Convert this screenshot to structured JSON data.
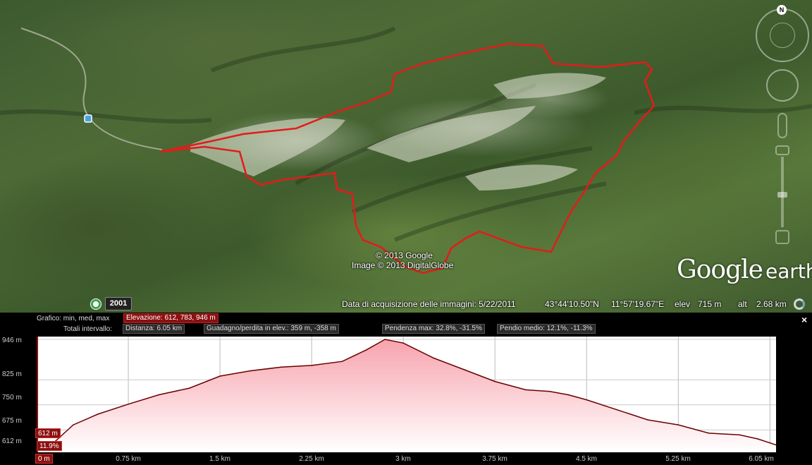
{
  "map": {
    "copyright_google": "© 2013 Google",
    "copyright_imagery": "Image © 2013 DigitalGlobe",
    "logo_google": "Google",
    "logo_earth": "earth",
    "compass_north": "N",
    "historical_year": "2001"
  },
  "status": {
    "imagery_date": "Data di acquisizione delle immagini: 5/22/2011",
    "latitude": "43°44'10.50\"N",
    "longitude": "11°57'19.67\"E",
    "elev_label": "elev",
    "elev_value": "715 m",
    "alt_label": "alt",
    "alt_value": "2.68 km"
  },
  "profile": {
    "graph_label": "Grafico: min, med, max",
    "elevation": "Elevazione: 612, 783, 946 m",
    "totals_label": "Totali intervallo:",
    "distance": "Distanza: 6.05 km",
    "gain_loss": "Guadagno/perdita in elev.: 359 m, -358 m",
    "max_slope": "Pendenza max: 32.8%, -31.5%",
    "avg_slope": "Pendio medio: 12.1%, -11.3%",
    "close": "×",
    "cursor_elev": "612 m",
    "cursor_slope": "11.9%",
    "cursor_dist": "0 m"
  },
  "chart_data": {
    "type": "area",
    "y_ticks": [
      "946 m",
      "825 m",
      "750 m",
      "675 m",
      "612 m"
    ],
    "x_ticks": [
      "0.75 km",
      "1.5 km",
      "2.25 km",
      "3 km",
      "3.75 km",
      "4.5 km",
      "5.25 km",
      "6.05 km"
    ],
    "ylim": [
      612,
      946
    ],
    "xlim": [
      0,
      6.05
    ],
    "x": [
      0,
      0.15,
      0.3,
      0.5,
      0.75,
      1.0,
      1.25,
      1.5,
      1.75,
      2.0,
      2.25,
      2.5,
      2.7,
      2.85,
      3.0,
      3.25,
      3.5,
      3.75,
      4.0,
      4.2,
      4.35,
      4.5,
      4.75,
      5.0,
      5.25,
      5.5,
      5.75,
      5.9,
      6.05
    ],
    "y": [
      612,
      640,
      690,
      722,
      752,
      780,
      800,
      836,
      852,
      863,
      868,
      880,
      915,
      946,
      935,
      890,
      855,
      820,
      795,
      790,
      780,
      765,
      735,
      705,
      690,
      665,
      660,
      648,
      630
    ],
    "colors": {
      "line": "#6b0000",
      "fill_top": "#f7a3ad",
      "fill_bottom": "#ffffff",
      "accent": "#8b1010"
    }
  }
}
